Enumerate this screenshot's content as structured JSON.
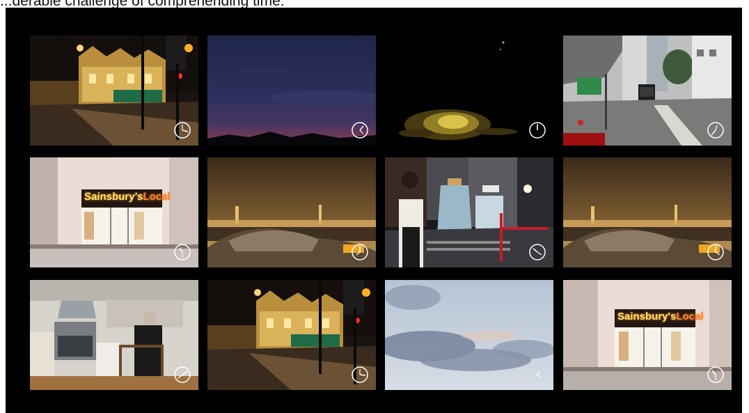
{
  "caption": "...derable challenge of comprehending time.",
  "grid": {
    "rows": 3,
    "cols": 4,
    "tiles": [
      {
        "scene": "night-street-pub",
        "clock": "clock-icon"
      },
      {
        "scene": "dusk-sky",
        "clock": "clock-icon"
      },
      {
        "scene": "city-lights-aerial-night",
        "clock": "clock-icon"
      },
      {
        "scene": "hong-kong-tram-street",
        "clock": "clock-icon"
      },
      {
        "scene": "sainsburys-local-storefront",
        "clock": "clock-icon",
        "sign": {
          "brand": "Sainsbury's",
          "local": "Local"
        }
      },
      {
        "scene": "harbour-skyline-night",
        "clock": "clock-icon"
      },
      {
        "scene": "night-street-pedestrian",
        "clock": "clock-icon"
      },
      {
        "scene": "harbour-skyline-night",
        "clock": "clock-icon"
      },
      {
        "scene": "kitchen-interior",
        "clock": "clock-icon"
      },
      {
        "scene": "night-street-pub",
        "clock": "clock-icon"
      },
      {
        "scene": "cloudy-sky",
        "clock": "clock-icon"
      },
      {
        "scene": "sainsburys-local-storefront",
        "clock": "clock-icon",
        "sign": {
          "brand": "Sainsbury's",
          "local": "Local"
        }
      }
    ]
  }
}
